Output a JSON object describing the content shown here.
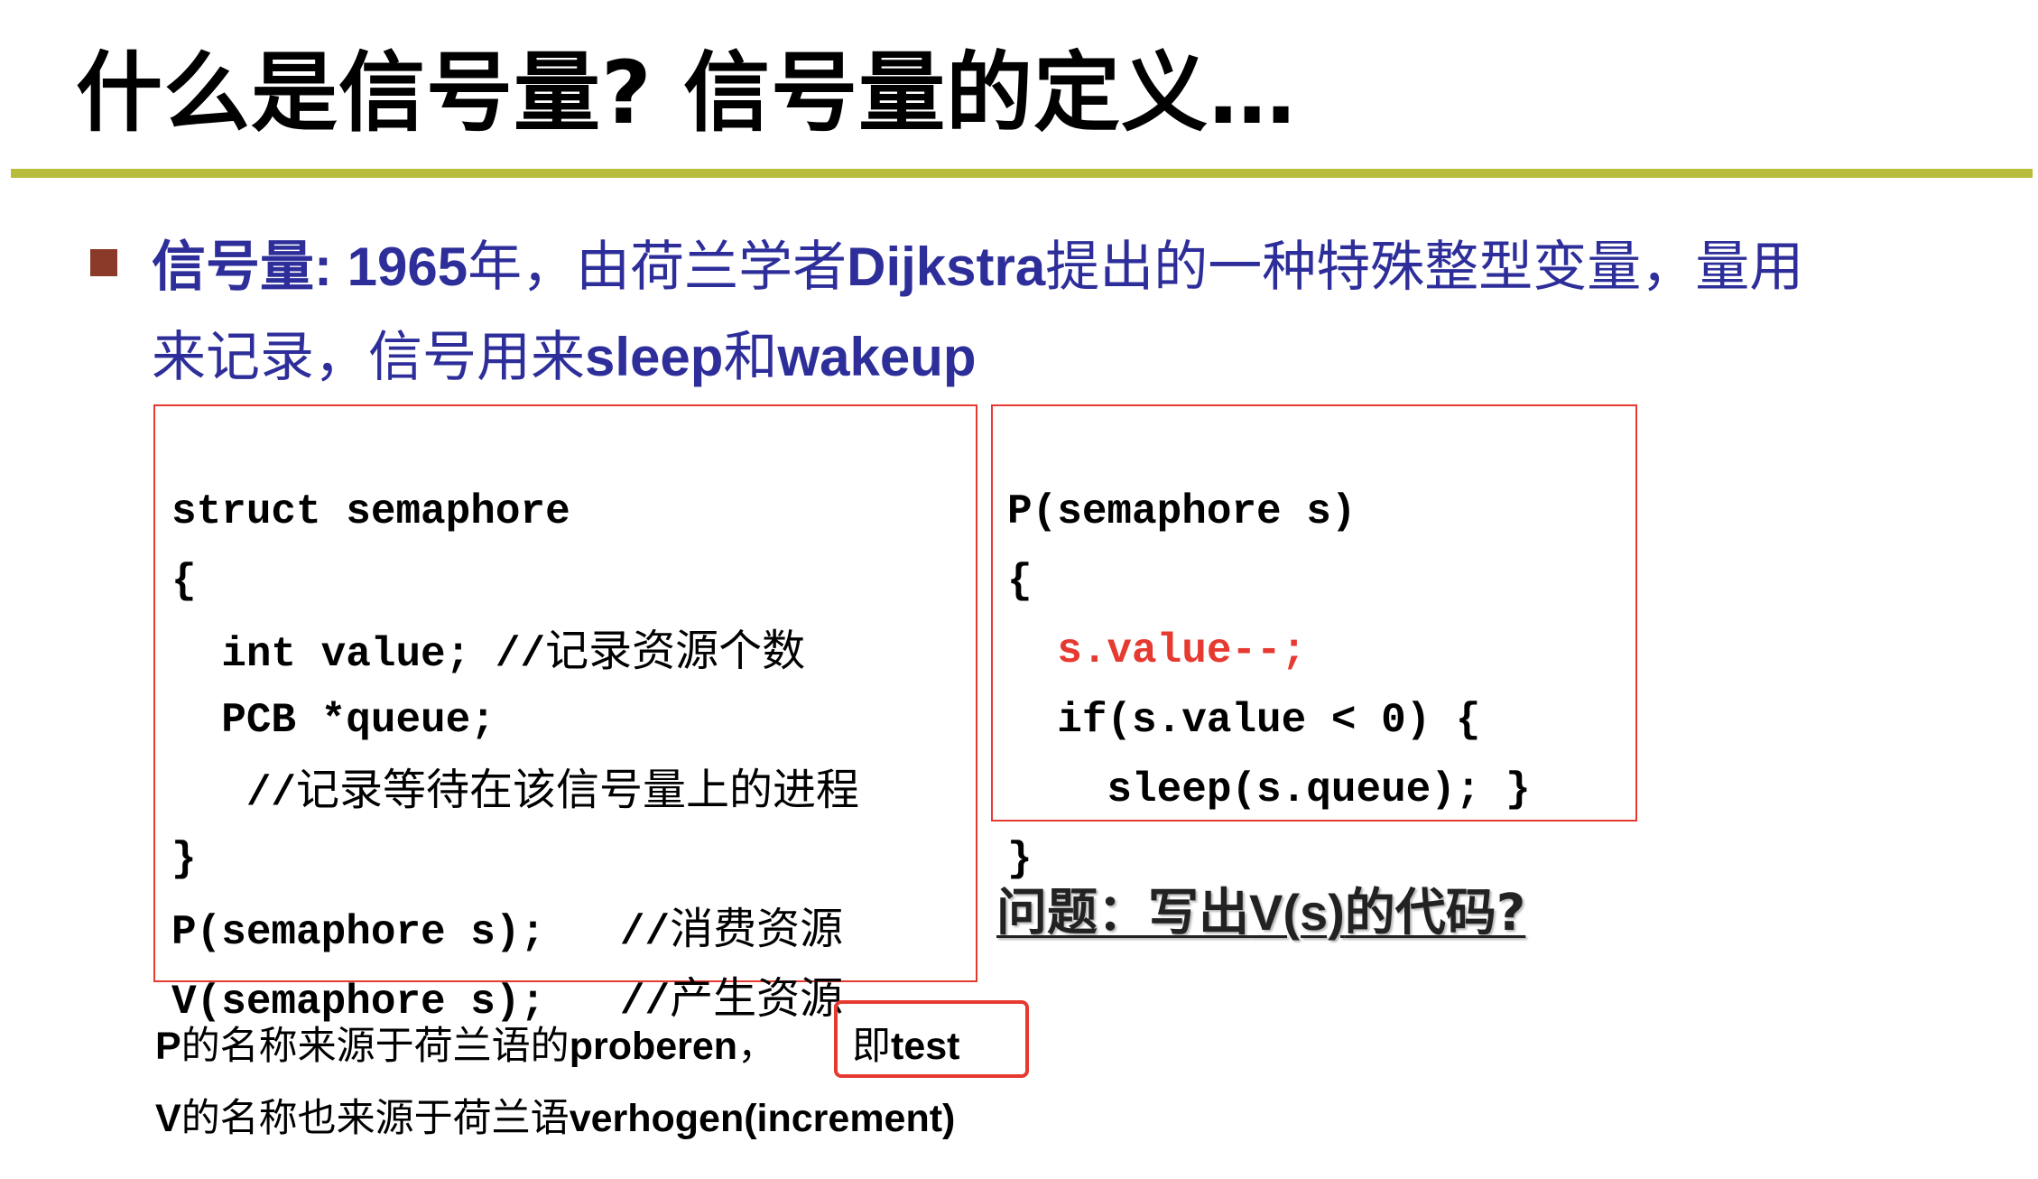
{
  "title": "什么是信号量? 信号量的定义…",
  "bullet": {
    "line1_a": "信号量: 1965",
    "line1_b": "年，由荷兰学者",
    "line1_c": "Dijkstra",
    "line1_d": "提出的一种特殊整型变量，量用",
    "line2_a": "来记录，信号用来",
    "line2_b": "sleep",
    "line2_c": "和",
    "line2_d": "wakeup"
  },
  "code_left": {
    "l1": "struct semaphore",
    "l2": "{",
    "l3_code": "  int value; //",
    "l3_comment": "记录资源个数",
    "l4": "  PCB *queue;",
    "l5_code": "   //",
    "l5_comment": "记录等待在该信号量上的进程",
    "l6": "}",
    "l7_code": "P(semaphore s);   //",
    "l7_comment": "消费资源",
    "l8_code": "V(semaphore s);   //",
    "l8_comment": "产生资源"
  },
  "code_right": {
    "l1": "P(semaphore s)",
    "l2": "{",
    "l3": "  s.value--;",
    "l4": "  if(s.value < 0) {",
    "l5": "    sleep(s.queue); }",
    "l6": "}"
  },
  "question": {
    "part1": "问题：写出",
    "part2": "V(s)",
    "part3": "的代码?"
  },
  "note1": {
    "a": "P",
    "b": "的名称来源于荷兰语的",
    "c": "proberen",
    "d": "，"
  },
  "test": {
    "a": "即",
    "b": "test"
  },
  "note2": {
    "a": "V",
    "b": "的名称也来源于荷兰语",
    "c": "verhogen(increment)"
  },
  "colors": {
    "rule": "#b7bd3b",
    "bullet_text": "#2e2e9a",
    "bullet_square": "#8b3a2a",
    "box_border": "#e63a31",
    "highlight_code": "#e63a31"
  }
}
